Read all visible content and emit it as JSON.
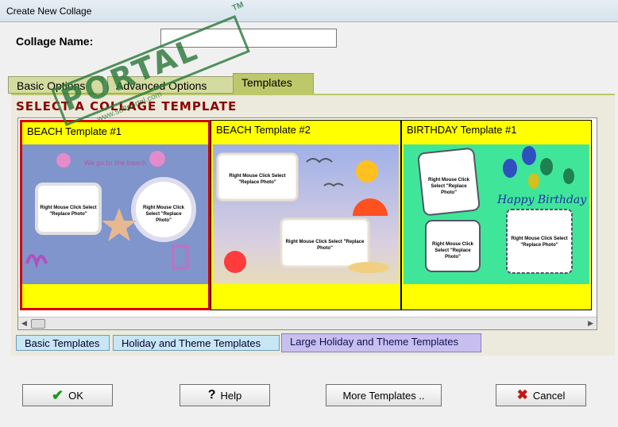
{
  "window": {
    "title": "Create New Collage"
  },
  "form": {
    "name_label": "Collage Name:",
    "name_value": "",
    "name_placeholder": ""
  },
  "top_tabs": [
    {
      "label": "Basic Options"
    },
    {
      "label": "Advanced Options"
    },
    {
      "label": "Templates"
    }
  ],
  "section_title": "SELECT A COLLAGE TEMPLATE",
  "templates": [
    {
      "title": "BEACH Template #1",
      "selected": true,
      "frame_text": "Right Mouse Click Select \"Replace Photo\""
    },
    {
      "title": "BEACH Template #2",
      "selected": false,
      "frame_text": "Right Mouse Click Select \"Replace Photo\""
    },
    {
      "title": "BIRTHDAY Template #1",
      "selected": false,
      "frame_text": "Right Mouse Click Select \"Replace Photo\"",
      "banner": "Happy Birthday"
    }
  ],
  "bottom_tabs": [
    {
      "label": "Basic Templates"
    },
    {
      "label": "Holiday and Theme Templates"
    },
    {
      "label": "Large Holiday and Theme Templates"
    }
  ],
  "buttons": {
    "ok": "OK",
    "help": "Help",
    "more": "More Templates ..",
    "cancel": "Cancel"
  },
  "watermark": {
    "brand": "PORTAL",
    "tm": "TM",
    "url": "www.softportal.com"
  },
  "colors": {
    "accent": "#bcc86a",
    "selected_border": "#d40000",
    "card_bg": "#ffff00",
    "title_red": "#8b0000"
  }
}
